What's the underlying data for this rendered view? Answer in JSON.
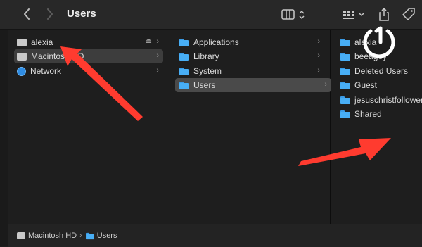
{
  "window": {
    "title": "Users"
  },
  "toolbar": {
    "back_icon": "chevron-left-icon",
    "forward_icon": "chevron-right-icon",
    "view_icon": "columns-view-icon",
    "group_icon": "grid-group-icon",
    "share_icon": "share-icon",
    "tag_icon": "tag-icon"
  },
  "columns": {
    "col1": [
      {
        "label": "alexia",
        "icon": "disk-icon",
        "eject": true
      },
      {
        "label": "Macintosh HD",
        "icon": "disk-icon"
      },
      {
        "label": "Network",
        "icon": "globe-icon"
      }
    ],
    "col2": [
      {
        "label": "Applications",
        "icon": "folder-icon"
      },
      {
        "label": "Library",
        "icon": "folder-icon"
      },
      {
        "label": "System",
        "icon": "folder-icon"
      },
      {
        "label": "Users",
        "icon": "folder-icon",
        "selected": true
      }
    ],
    "col3": [
      {
        "label": "alexia",
        "icon": "folder-icon"
      },
      {
        "label": "beeagey",
        "icon": "folder-icon"
      },
      {
        "label": "Deleted Users",
        "icon": "folder-icon"
      },
      {
        "label": "Guest",
        "icon": "folder-icon"
      },
      {
        "label": "jesuschristfollower",
        "icon": "folder-icon"
      },
      {
        "label": "Shared",
        "icon": "folder-icon"
      }
    ]
  },
  "pathbar": {
    "items": [
      "Macintosh HD",
      "Users"
    ]
  },
  "annotations": {
    "arrow_color": "#ff3b2f"
  },
  "colors": {
    "folder": "#48aef5",
    "background": "#1e1e1e",
    "toolbar": "#282828"
  }
}
